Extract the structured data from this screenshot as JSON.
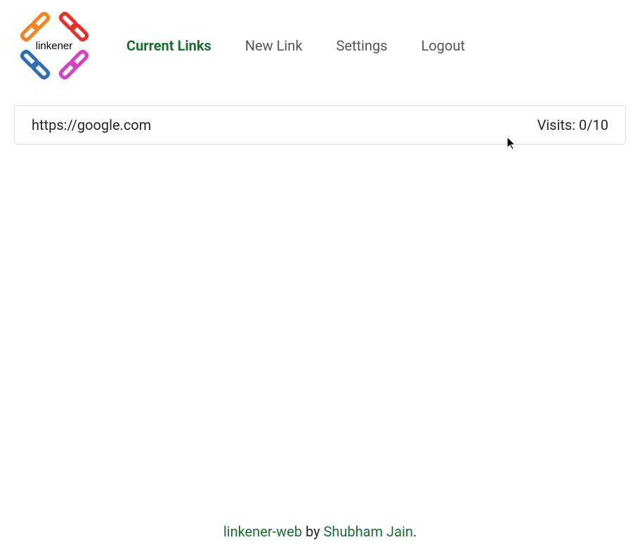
{
  "brand": {
    "name": "linkener"
  },
  "nav": {
    "items": [
      {
        "label": "Current Links",
        "active": true
      },
      {
        "label": "New Link",
        "active": false
      },
      {
        "label": "Settings",
        "active": false
      },
      {
        "label": "Logout",
        "active": false
      }
    ]
  },
  "links": [
    {
      "url": "https://google.com",
      "visits_label": "Visits: 0/10"
    }
  ],
  "footer": {
    "project_name": "linkener-web",
    "by_text": " by ",
    "author": "Shubham Jain",
    "period": "."
  }
}
